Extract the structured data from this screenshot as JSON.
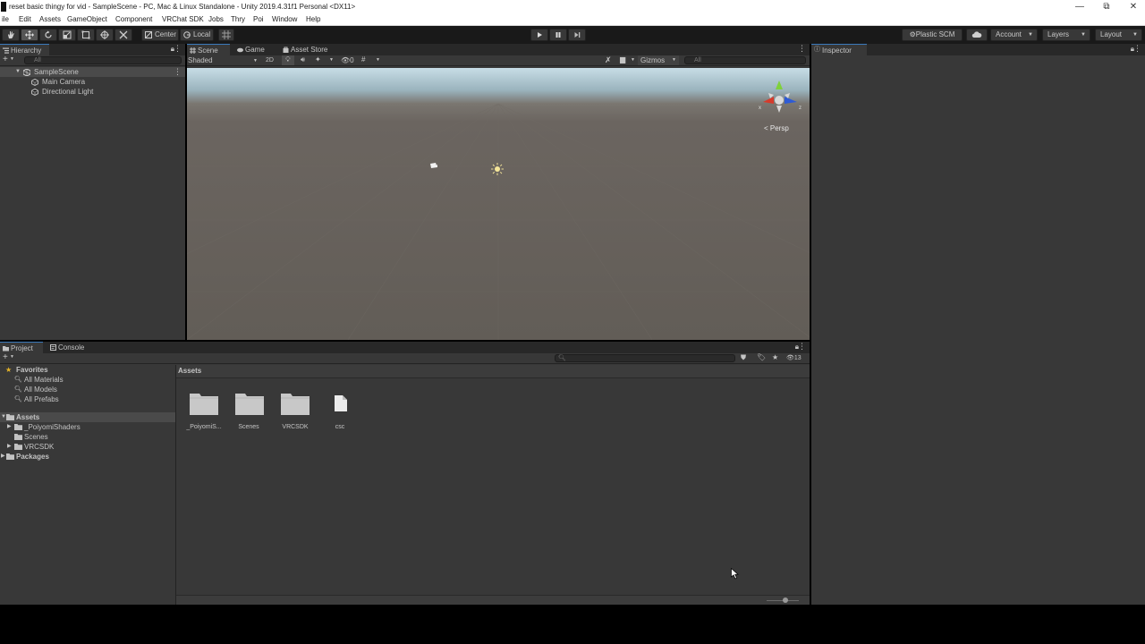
{
  "window": {
    "title": "reset basic thingy for vid - SampleScene - PC, Mac & Linux Standalone - Unity 2019.4.31f1 Personal <DX11>",
    "minimize": "—",
    "maximize": "⧉",
    "close": "✕"
  },
  "menu": {
    "items": [
      "ile",
      "Edit",
      "Assets",
      "GameObject",
      "Component",
      "VRChat SDK",
      "Jobs",
      "Thry",
      "Poi",
      "Window",
      "Help"
    ]
  },
  "toolbar": {
    "center": "Center",
    "local": "Local",
    "plastic": "Plastic SCM",
    "account": "Account",
    "layers": "Layers",
    "layout": "Layout"
  },
  "hierarchy": {
    "tab": "Hierarchy",
    "search_placeholder": "All",
    "scene": "SampleScene",
    "items": [
      "Main Camera",
      "Directional Light"
    ]
  },
  "scene_panel": {
    "tabs": [
      "Scene",
      "Game",
      "Asset Store"
    ],
    "shading": "Shaded",
    "mode2d": "2D",
    "fx_count": "0",
    "gizmos": "Gizmos",
    "search_placeholder": "All",
    "persp": "< Persp"
  },
  "inspector": {
    "tab": "Inspector"
  },
  "project": {
    "tabs": [
      "Project",
      "Console"
    ],
    "favorites": "Favorites",
    "favorite_items": [
      "All Materials",
      "All Models",
      "All Prefabs"
    ],
    "assets_root": "Assets",
    "asset_folders": [
      "_PoiyomiShaders",
      "Scenes",
      "VRCSDK"
    ],
    "packages": "Packages",
    "breadcrumb": "Assets",
    "hidden_count": "13",
    "grid_items": [
      "_PoiyomiS...",
      "Scenes",
      "VRCSDK",
      "csc"
    ]
  },
  "colors": {
    "accent": "#3a79bb",
    "panel_bg": "#383838",
    "toolbar_bg": "#191919",
    "gizmo_y": "#7fd13b",
    "gizmo_x": "#d63b2c",
    "gizmo_z": "#2e5bd6"
  }
}
